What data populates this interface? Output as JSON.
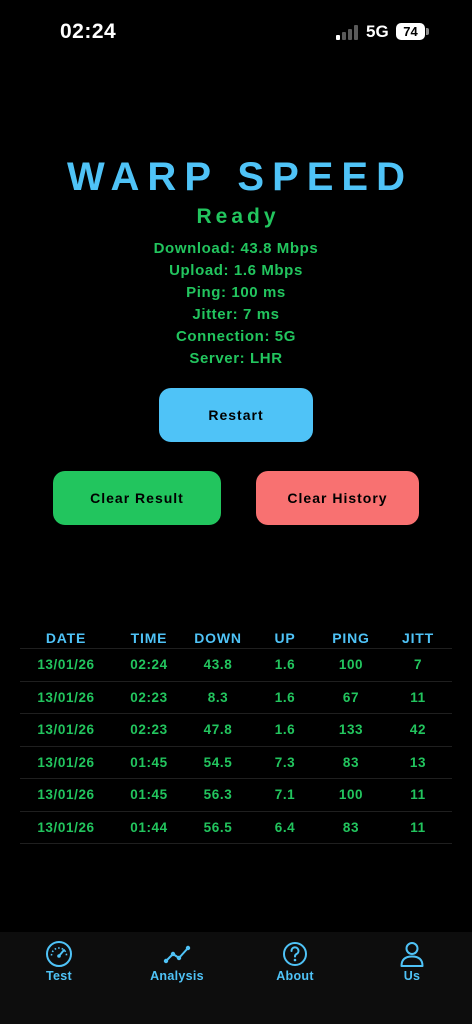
{
  "status_bar": {
    "time": "02:24",
    "network": "5G",
    "battery": "74",
    "signal_bars_on": 1,
    "signal_bars_total": 4
  },
  "header": {
    "title": "WARP SPEED",
    "status": "Ready"
  },
  "stats": {
    "download": "Download: 43.8 Mbps",
    "upload": "Upload: 1.6 Mbps",
    "ping": "Ping: 100 ms",
    "jitter": "Jitter: 7 ms",
    "connection": "Connection: 5G",
    "server": "Server: LHR"
  },
  "buttons": {
    "restart": "Restart",
    "clear_result": "Clear Result",
    "clear_history": "Clear History"
  },
  "history": {
    "columns": [
      "DATE",
      "TIME",
      "DOWN",
      "UP",
      "PING",
      "JITT"
    ],
    "rows": [
      [
        "13/01/26",
        "02:24",
        "43.8",
        "1.6",
        "100",
        "7"
      ],
      [
        "13/01/26",
        "02:23",
        "8.3",
        "1.6",
        "67",
        "11"
      ],
      [
        "13/01/26",
        "02:23",
        "47.8",
        "1.6",
        "133",
        "42"
      ],
      [
        "13/01/26",
        "01:45",
        "54.5",
        "7.3",
        "83",
        "13"
      ],
      [
        "13/01/26",
        "01:45",
        "56.3",
        "7.1",
        "100",
        "11"
      ],
      [
        "13/01/26",
        "01:44",
        "56.5",
        "6.4",
        "83",
        "11"
      ]
    ]
  },
  "tabs": [
    {
      "label": "Test",
      "icon": "speedometer-icon"
    },
    {
      "label": "Analysis",
      "icon": "line-chart-icon"
    },
    {
      "label": "About",
      "icon": "question-circle-icon"
    },
    {
      "label": "Us",
      "icon": "person-icon"
    }
  ],
  "colors": {
    "background": "#000000",
    "accent_blue": "#4fc3f7",
    "accent_green": "#22c55e",
    "accent_red": "#f87171",
    "tab_bar": "#0d0d0d"
  }
}
